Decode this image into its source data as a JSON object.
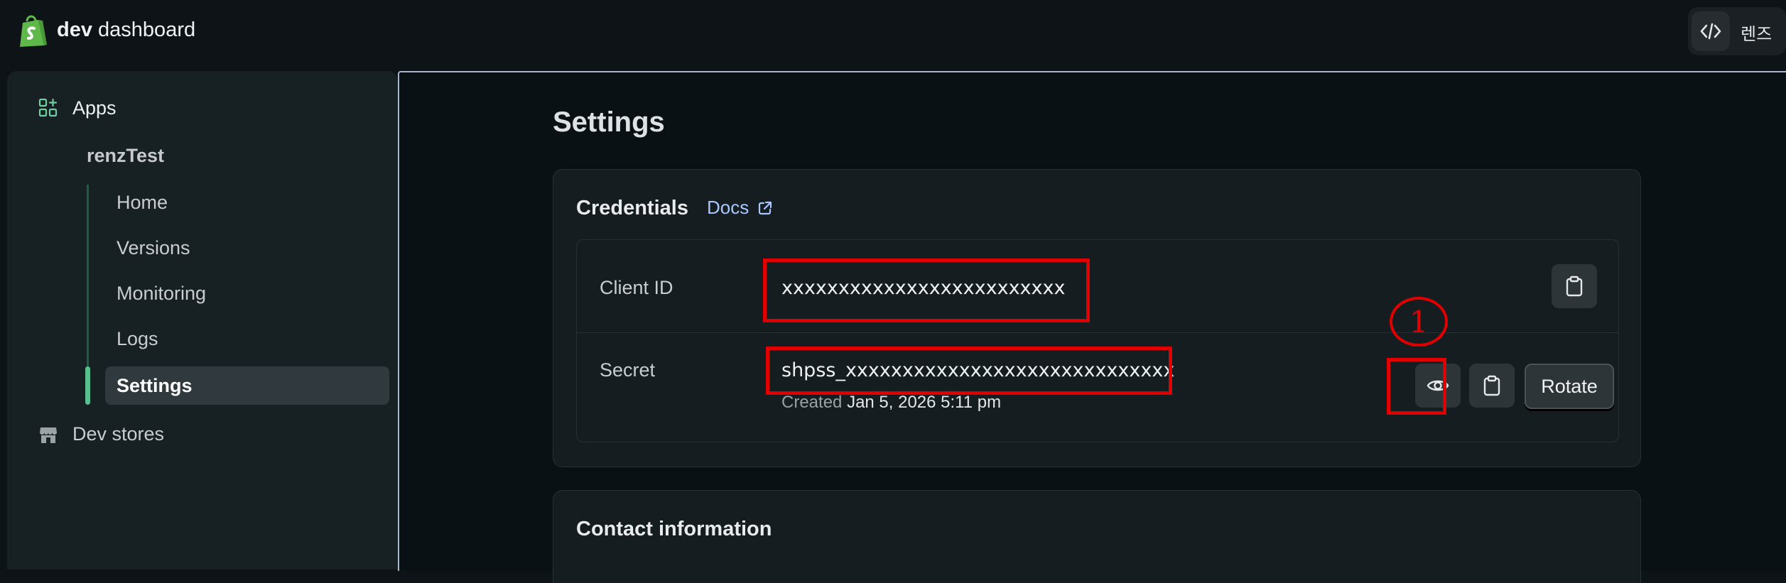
{
  "header": {
    "brand_bold": "dev",
    "brand_rest": "dashboard",
    "lens_label": "렌즈",
    "code_icon": "code-brackets-icon"
  },
  "sidebar": {
    "apps_label": "Apps",
    "app_name": "renzTest",
    "items": [
      {
        "label": "Home"
      },
      {
        "label": "Versions"
      },
      {
        "label": "Monitoring"
      },
      {
        "label": "Logs"
      },
      {
        "label": "Settings",
        "active": true
      }
    ],
    "dev_stores_label": "Dev stores",
    "accent_color": "#58c08e"
  },
  "main": {
    "page_title": "Settings",
    "credentials": {
      "title": "Credentials",
      "docs_label": "Docs",
      "client_id_label": "Client ID",
      "client_id_value": "xxxxxxxxxxxxxxxxxxxxxxxxx",
      "secret_label": "Secret",
      "secret_value": "shpss_xxxxxxxxxxxxxxxxxxxxxxxxxxxxx",
      "created_label": "Created",
      "created_value": "Jan 5, 2026 5:11 pm",
      "rotate_label": "Rotate"
    },
    "contact": {
      "title": "Contact information"
    }
  },
  "annotation": {
    "marker_number": "1",
    "color": "#e00000"
  }
}
